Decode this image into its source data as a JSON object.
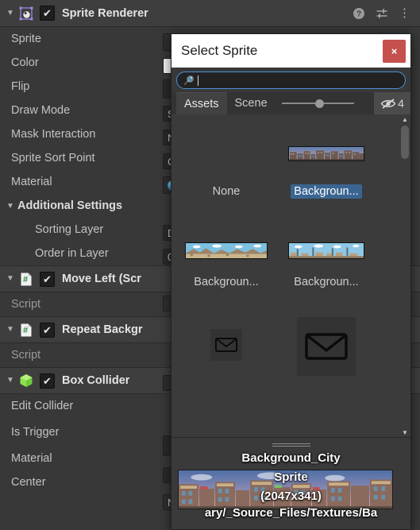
{
  "inspector": {
    "component_header": {
      "title": "Sprite Renderer",
      "foldout": "▼",
      "checkmark": "✔",
      "icon_name": "sprite-renderer-icon",
      "help_icon": "?",
      "preset_icon": "preset-sliders-icon",
      "menu_icon": "⋮"
    },
    "sprite_renderer_props": [
      {
        "label": "Sprite",
        "value": ""
      },
      {
        "label": "Color",
        "value": ""
      },
      {
        "label": "Flip",
        "value": ""
      },
      {
        "label": "Draw Mode",
        "value": "S"
      },
      {
        "label": "Mask Interaction",
        "value": "N"
      },
      {
        "label": "Sprite Sort Point",
        "value": "C"
      },
      {
        "label": "Material",
        "value": ""
      }
    ],
    "additional_settings": {
      "label": "Additional Settings",
      "foldout": "▼",
      "props": [
        {
          "label": "Sorting Layer",
          "value": "D"
        },
        {
          "label": "Order in Layer",
          "value": "0"
        }
      ]
    },
    "components": [
      {
        "title": "Move Left (Scr",
        "icon_name": "cs-script-icon",
        "foldout": "▼",
        "checkmark": "✔",
        "props": [
          {
            "label": "Script",
            "value": ""
          }
        ]
      },
      {
        "title": "Repeat Backgr",
        "icon_name": "cs-script-icon",
        "foldout": "▼",
        "checkmark": "✔",
        "props": [
          {
            "label": "Script",
            "value": ""
          }
        ]
      },
      {
        "title": "Box Collider",
        "icon_name": "box-collider-icon",
        "foldout": "▼",
        "checkmark": "✔",
        "props": [
          {
            "label": "Edit Collider",
            "value": ""
          },
          {
            "label": "Is Trigger",
            "value": ""
          },
          {
            "label": "Material",
            "value": "N"
          },
          {
            "label": "Center",
            "value": "X"
          }
        ]
      }
    ]
  },
  "modal": {
    "title": "Select Sprite",
    "close_label": "×",
    "search": {
      "value": "",
      "placeholder": "",
      "icon": "search-icon"
    },
    "tabs": [
      {
        "label": "Assets",
        "active": true
      },
      {
        "label": "Scene",
        "active": false
      }
    ],
    "zoom_slider": {
      "value": 62
    },
    "visibility": {
      "icon": "eye-off-icon",
      "count": "4"
    },
    "grid_items": [
      {
        "label": "None",
        "selected": false,
        "thumb": "none"
      },
      {
        "label": "Backgroun...",
        "selected": true,
        "thumb": "city-strip"
      },
      {
        "label": "Backgroun...",
        "selected": false,
        "thumb": "desert-strip"
      },
      {
        "label": "Backgroun...",
        "selected": false,
        "thumb": "town-strip"
      },
      {
        "label": "",
        "selected": false,
        "thumb": "mail-small"
      },
      {
        "label": "",
        "selected": false,
        "thumb": "mail-large"
      }
    ],
    "preview": {
      "name": "Background_City",
      "type": "Sprite",
      "dimensions": "(2047x341)",
      "path": "ary/_Source_Files/Textures/Ba"
    },
    "scrollbar": {
      "up": "▲",
      "down": "▼"
    }
  },
  "colors": {
    "accent_blue": "#3a6591",
    "close_red": "#c5504e",
    "panel_bg": "#383838",
    "focus_ring": "#4a90d9"
  }
}
